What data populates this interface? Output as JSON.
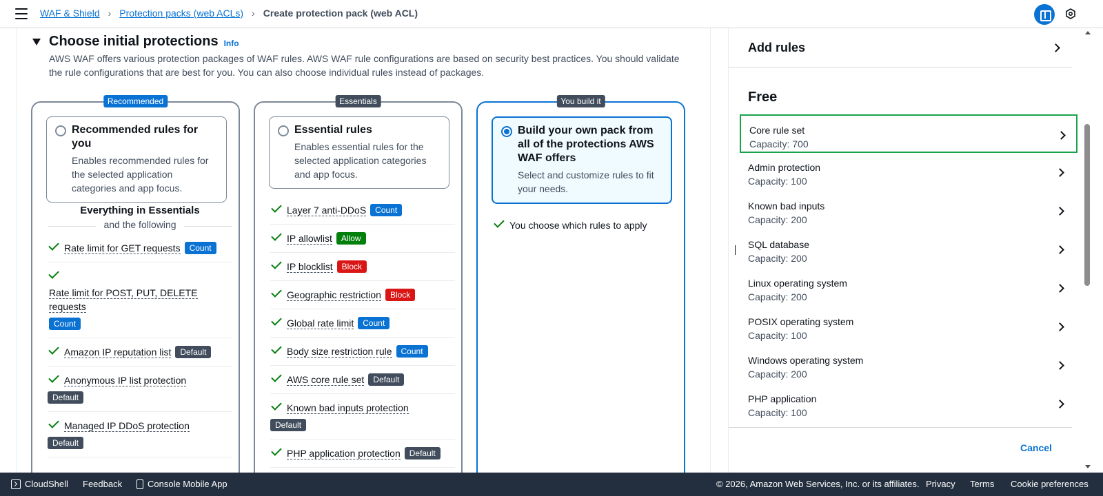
{
  "header": {
    "breadcrumbs": [
      "WAF & Shield",
      "Protection packs (web ACLs)",
      "Create protection pack (web ACL)"
    ]
  },
  "section": {
    "title": "Choose initial protections",
    "info": "Info",
    "description": "AWS WAF offers various protection packages of WAF rules. AWS WAF rule configurations are based on security best practices. You should validate the rule configurations that are best for you. You can also choose individual rules instead of packages."
  },
  "packs": {
    "recommended": {
      "badge": "Recommended",
      "title": "Recommended rules for you",
      "desc": "Enables recommended rules for the selected application categories and app focus.",
      "everything": "Everything in Essentials",
      "and_following": "and the following",
      "rules": [
        {
          "label": "Rate limit for GET requests",
          "tag": "Count"
        },
        {
          "label": "Rate limit for POST, PUT, DELETE requests",
          "tag": "Count"
        },
        {
          "label": "Amazon IP reputation list",
          "tag": "Default"
        },
        {
          "label": "Anonymous IP list protection",
          "tag": "Default"
        },
        {
          "label": "Managed IP DDoS protection",
          "tag": "Default"
        }
      ]
    },
    "essentials": {
      "badge": "Essentials",
      "title": "Essential rules",
      "desc": "Enables essential rules for the selected application categories and app focus.",
      "rules": [
        {
          "label": "Layer 7 anti-DDoS",
          "tag": "Count"
        },
        {
          "label": "IP allowlist",
          "tag": "Allow"
        },
        {
          "label": "IP blocklist",
          "tag": "Block"
        },
        {
          "label": "Geographic restriction",
          "tag": "Block"
        },
        {
          "label": "Global rate limit",
          "tag": "Count"
        },
        {
          "label": "Body size restriction rule",
          "tag": "Count"
        },
        {
          "label": "AWS core rule set",
          "tag": "Default"
        },
        {
          "label": "Known bad inputs protection",
          "tag": "Default"
        },
        {
          "label": "PHP application protection",
          "tag": "Default"
        }
      ]
    },
    "custom": {
      "badge": "You build it",
      "title": "Build your own pack from all of the protections AWS WAF offers",
      "desc": "Select and customize rules to fit your needs.",
      "note": "You choose which rules to apply"
    }
  },
  "panel": {
    "add_rules": "Add rules",
    "free": "Free",
    "items": [
      {
        "name": "Core rule set",
        "capacity": "Capacity: 700"
      },
      {
        "name": "Admin protection",
        "capacity": "Capacity: 100"
      },
      {
        "name": "Known bad inputs",
        "capacity": "Capacity: 200"
      },
      {
        "name": "SQL database",
        "capacity": "Capacity: 200"
      },
      {
        "name": "Linux operating system",
        "capacity": "Capacity: 200"
      },
      {
        "name": "POSIX operating system",
        "capacity": "Capacity: 100"
      },
      {
        "name": "Windows operating system",
        "capacity": "Capacity: 200"
      },
      {
        "name": "PHP application",
        "capacity": "Capacity: 100"
      }
    ],
    "cancel": "Cancel"
  },
  "footer": {
    "cloudshell": "CloudShell",
    "feedback": "Feedback",
    "mobile": "Console Mobile App",
    "copyright": "© 2026, Amazon Web Services, Inc. or its affiliates.",
    "privacy": "Privacy",
    "terms": "Terms",
    "cookies": "Cookie preferences"
  },
  "colors": {
    "accent": "#0972d3",
    "count": "#0972d3",
    "allow": "#037f0c",
    "block": "#d91515",
    "default": "#414d5c",
    "highlight": "#16a34a",
    "footer_bg": "#232f3e"
  }
}
